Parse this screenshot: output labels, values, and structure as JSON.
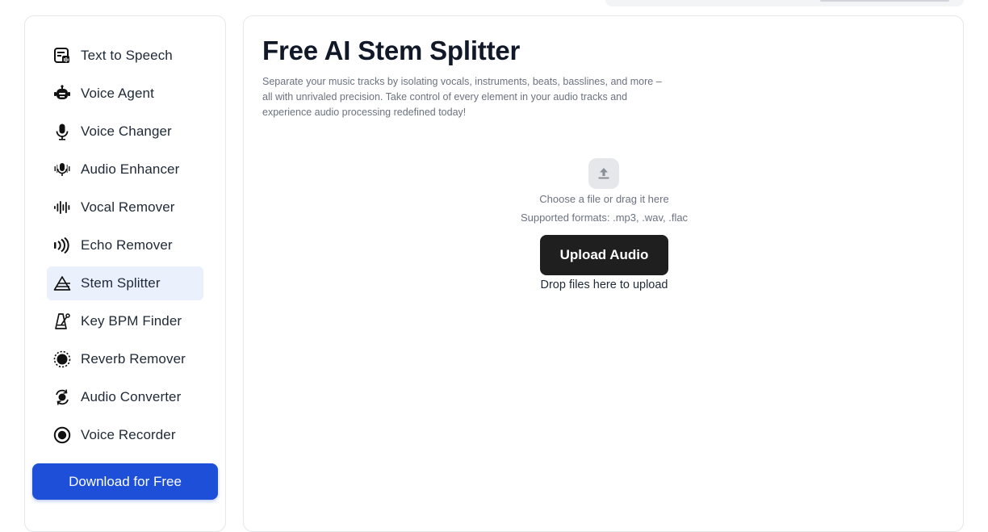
{
  "sidebar": {
    "items": [
      {
        "label": "Text to Speech",
        "icon": "text-to-speech-icon",
        "active": false
      },
      {
        "label": "Voice Agent",
        "icon": "robot-icon",
        "active": false
      },
      {
        "label": "Voice Changer",
        "icon": "microphone-icon",
        "active": false
      },
      {
        "label": "Audio Enhancer",
        "icon": "enhanced-mic-icon",
        "active": false
      },
      {
        "label": "Vocal Remover",
        "icon": "waveform-icon",
        "active": false
      },
      {
        "label": "Echo Remover",
        "icon": "echo-waves-icon",
        "active": false
      },
      {
        "label": "Stem Splitter",
        "icon": "triangle-split-icon",
        "active": true
      },
      {
        "label": "Key BPM Finder",
        "icon": "metronome-icon",
        "active": false
      },
      {
        "label": "Reverb Remover",
        "icon": "reverb-circle-icon",
        "active": false
      },
      {
        "label": "Audio Converter",
        "icon": "convert-icon",
        "active": false
      },
      {
        "label": "Voice Recorder",
        "icon": "record-icon",
        "active": false
      }
    ],
    "download_label": "Download for Free"
  },
  "main": {
    "title": "Free AI Stem Splitter",
    "description": "Separate your music tracks by isolating vocals, instruments, beats, basslines, and more – all with unrivaled precision. Take control of every element in your audio tracks and experience audio processing redefined today!",
    "upload": {
      "icon": "upload-icon",
      "choose_text": "Choose a file or drag it here",
      "formats_text": "Supported formats: .mp3, .wav, .flac",
      "button_label": "Upload Audio",
      "drop_text": "Drop files here to upload"
    }
  },
  "colors": {
    "accent": "#1d4fd8",
    "active_bg": "#eaf1fd",
    "upload_button": "#1f1f1f"
  }
}
